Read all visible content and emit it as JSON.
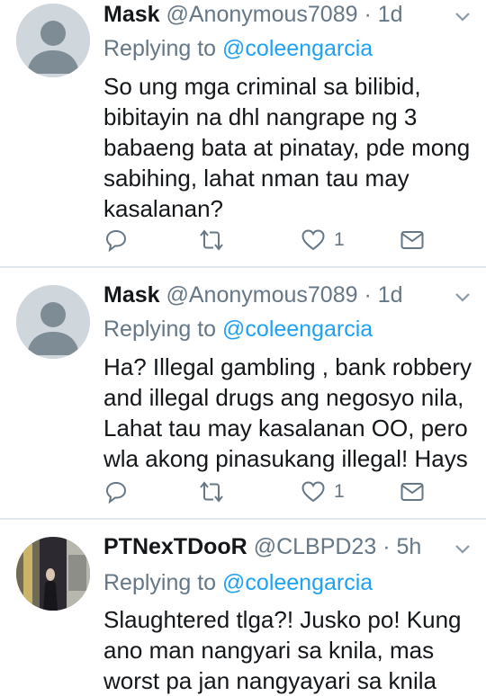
{
  "tweets": [
    {
      "name": "Mask",
      "handle": "@Anonymous7089",
      "separator": "·",
      "time": "1d",
      "replying_prefix": "Replying to",
      "replying_to": "@coleengarcia",
      "lines": [
        "So ung mga criminal sa bilibid,",
        "bibitayin na dhl nangrape ng 3",
        "babaeng bata at pinatay, pde mong",
        "sabihing, lahat nman tau may",
        "kasalanan?"
      ],
      "like_count": "1",
      "avatar": "default-avatar"
    },
    {
      "name": "Mask",
      "handle": "@Anonymous7089",
      "separator": "·",
      "time": "1d",
      "replying_prefix": "Replying to",
      "replying_to": "@coleengarcia",
      "lines": [
        "Ha? Illegal gambling , bank robbery",
        "and illegal drugs ang negosyo nila,",
        "Lahat tau may kasalanan OO, pero",
        "wla akong pinasukang illegal! Hays"
      ],
      "like_count": "1",
      "avatar": "default-avatar"
    },
    {
      "name": "PTNexTDooR",
      "handle": "@CLBPD23",
      "separator": "·",
      "time": "5h",
      "replying_prefix": "Replying to",
      "replying_to": "@coleengarcia",
      "lines": [
        "Slaughtered tlga?! Jusko po! Kung",
        "ano man nangyari sa knila, mas",
        "worst pa jan nangyayari sa knila"
      ],
      "avatar": "photo-avatar"
    }
  ],
  "colors": {
    "text": "#14171a",
    "secondary": "#657786",
    "link": "#1da1f2",
    "divider": "#e1e8ed"
  }
}
